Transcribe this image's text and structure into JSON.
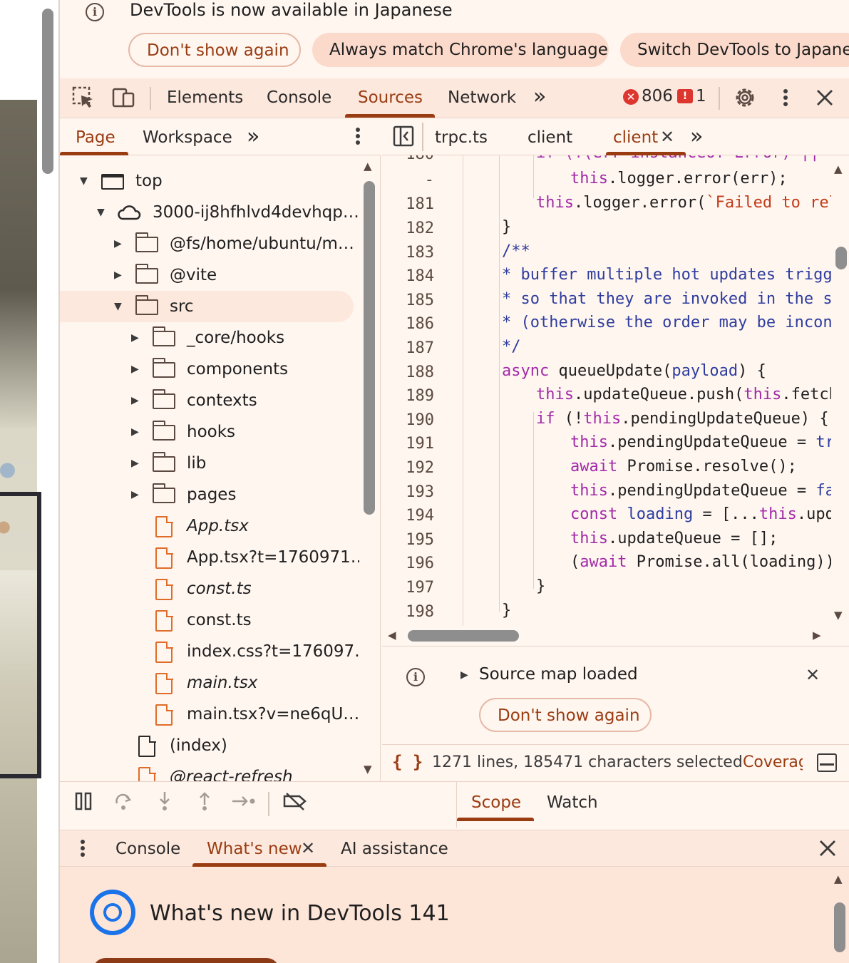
{
  "language_infobar": {
    "message": "DevTools is now available in Japanese",
    "dont_show": "Don't show again",
    "always_match": "Always match Chrome's language",
    "switch": "Switch DevTools to Japanese"
  },
  "main_toolbar": {
    "tabs": [
      {
        "label": "Elements"
      },
      {
        "label": "Console"
      },
      {
        "label": "Sources",
        "active": true
      },
      {
        "label": "Network"
      }
    ],
    "more_tabs": "»",
    "error_count": "806",
    "issue_count": "1"
  },
  "navigator": {
    "tabs": [
      {
        "label": "Page",
        "active": true
      },
      {
        "label": "Workspace"
      }
    ],
    "more_tabs": "»",
    "tree": [
      {
        "label": "top",
        "type": "frame",
        "expanded": true
      },
      {
        "label": "3000-ij8hfhlvd4devhqp…",
        "type": "cloud",
        "expanded": true
      },
      {
        "label": "@fs/home/ubuntu/m…",
        "type": "folder",
        "expanded": false
      },
      {
        "label": "@vite",
        "type": "folder",
        "expanded": false
      },
      {
        "label": "src",
        "type": "folder",
        "expanded": true,
        "selected": true
      },
      {
        "label": "_core/hooks",
        "type": "folder",
        "expanded": false
      },
      {
        "label": "components",
        "type": "folder",
        "expanded": false
      },
      {
        "label": "contexts",
        "type": "folder",
        "expanded": false
      },
      {
        "label": "hooks",
        "type": "folder",
        "expanded": false
      },
      {
        "label": "lib",
        "type": "folder",
        "expanded": false
      },
      {
        "label": "pages",
        "type": "folder",
        "expanded": false
      },
      {
        "label": "App.tsx",
        "type": "file",
        "italic": true
      },
      {
        "label": "App.tsx?t=1760971…",
        "type": "file"
      },
      {
        "label": "const.ts",
        "type": "file",
        "italic": true
      },
      {
        "label": "const.ts",
        "type": "file"
      },
      {
        "label": "index.css?t=176097…",
        "type": "file"
      },
      {
        "label": "main.tsx",
        "type": "file",
        "italic": true
      },
      {
        "label": "main.tsx?v=ne6qU…",
        "type": "file"
      },
      {
        "label": "(index)",
        "type": "file-plain"
      },
      {
        "label": "@react-refresh",
        "type": "file",
        "italic": true
      }
    ]
  },
  "editor": {
    "tabs": [
      {
        "label": "trpc.ts"
      },
      {
        "label": "client"
      },
      {
        "label": "client",
        "active": true
      }
    ],
    "more_tabs": "»",
    "lines": [
      {
        "num": "180",
        "text": "if (!(err instanceof Error) || !err"
      },
      {
        "num": "-",
        "text": "this.logger.error(err);"
      },
      {
        "num": "181",
        "text": "this.logger.error(`Failed to reload"
      },
      {
        "num": "182",
        "text": "}"
      },
      {
        "num": "183",
        "text": "/**"
      },
      {
        "num": "184",
        "text": "* buffer multiple hot updates triggered"
      },
      {
        "num": "185",
        "text": "* so that they are invoked in the same"
      },
      {
        "num": "186",
        "text": "* (otherwise the order may be inconsist"
      },
      {
        "num": "187",
        "text": "*/"
      },
      {
        "num": "188",
        "text": "async queueUpdate(payload) {"
      },
      {
        "num": "189",
        "text": "this.updateQueue.push(this.fetchUpd"
      },
      {
        "num": "190",
        "text": "if (!this.pendingUpdateQueue) {"
      },
      {
        "num": "191",
        "text": "this.pendingUpdateQueue = true"
      },
      {
        "num": "192",
        "text": "await Promise.resolve();"
      },
      {
        "num": "193",
        "text": "this.pendingUpdateQueue = false"
      },
      {
        "num": "194",
        "text": "const loading = [...this.update"
      },
      {
        "num": "195",
        "text": "this.updateQueue = [];"
      },
      {
        "num": "196",
        "text": "(await Promise.all(loading)).fo"
      },
      {
        "num": "197",
        "text": "}"
      },
      {
        "num": "198",
        "text": "}"
      }
    ]
  },
  "sourcemap_infobar": {
    "message": "Source map loaded",
    "dont_show": "Don't show again"
  },
  "status_bar": {
    "braces": "{ }",
    "text": "1271 lines, 185471 characters selected",
    "coverage": "Coverage"
  },
  "debugger": {
    "tabs": [
      {
        "label": "Scope",
        "active": true
      },
      {
        "label": "Watch"
      }
    ]
  },
  "drawer": {
    "tabs": [
      {
        "label": "Console"
      },
      {
        "label": "What's new",
        "active": true
      },
      {
        "label": "AI assistance"
      }
    ],
    "title": "What's new in DevTools 141"
  },
  "colors": {
    "accent": "#9a3c12",
    "background": "#fff6f0",
    "toolbar": "#fce8dd",
    "error": "#dc362e",
    "chrome_blue": "#1a73e8"
  }
}
